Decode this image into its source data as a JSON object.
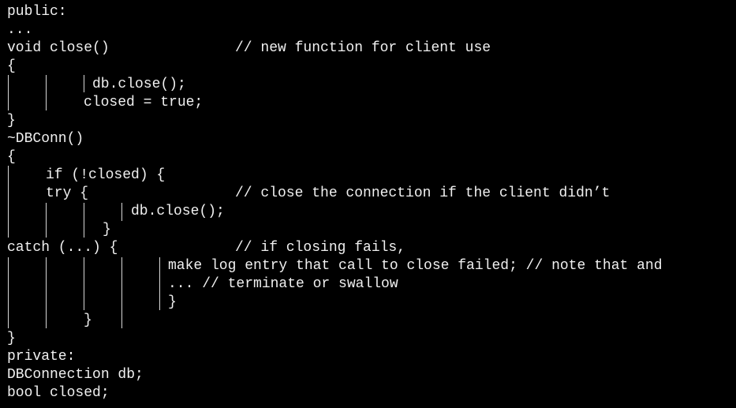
{
  "code_lines": [
    "public:",
    "...",
    "void close()",
    "// new function for client use",
    "{",
    "db.close();",
    "closed = true;",
    "}",
    "~DBConn()",
    "{",
    "if (!closed) {",
    "try {",
    "// close the connection if the client didn’t",
    "db.close();",
    "}",
    "catch (...) {",
    "// if closing fails,",
    "make log entry that call to close failed; // note that and",
    "... // terminate or swallow",
    "}",
    "}",
    "}",
    "private:",
    "DBConnection db;",
    "bool closed;"
  ],
  "colors": {
    "background": "#000000",
    "text": "#f0f0f0",
    "guide_line": "#d8d8d8"
  }
}
